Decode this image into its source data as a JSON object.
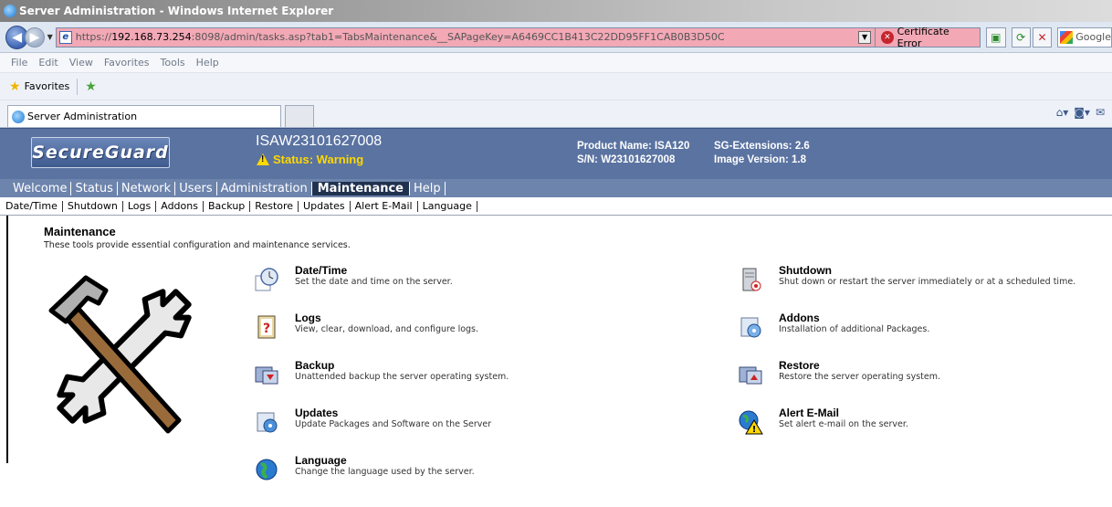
{
  "window": {
    "title": "Server Administration - Windows Internet Explorer"
  },
  "address": {
    "scheme": "https://",
    "host": "192.168.73.254",
    "rest": ":8098/admin/tasks.asp?tab1=TabsMaintenance&__SAPageKey=A6469CC1B413C22DD95FF1CAB0B3D50C",
    "cert_error": "Certificate Error",
    "search_placeholder": "Google"
  },
  "menu": [
    "File",
    "Edit",
    "View",
    "Favorites",
    "Tools",
    "Help"
  ],
  "favorites": {
    "label": "Favorites"
  },
  "browser_tab": {
    "label": "Server Administration"
  },
  "header": {
    "logo": "SecureGuard",
    "hostname": "ISAW23101627008",
    "status": "Status: Warning",
    "product_name": "Product Name: ISA120",
    "serial": "S/N: W23101627008",
    "sg_extensions": "SG-Extensions: 2.6",
    "image_version": "Image Version: 1.8"
  },
  "main_nav": [
    "Welcome",
    "Status",
    "Network",
    "Users",
    "Administration",
    "Maintenance",
    "Help"
  ],
  "sub_nav": [
    "Date/Time",
    "Shutdown",
    "Logs",
    "Addons",
    "Backup",
    "Restore",
    "Updates",
    "Alert E-Mail",
    "Language"
  ],
  "page": {
    "title": "Maintenance",
    "description": "These tools provide essential configuration and maintenance services."
  },
  "tasks": {
    "datetime": {
      "title": "Date/Time",
      "desc": "Set the date and time on the server."
    },
    "shutdown": {
      "title": "Shutdown",
      "desc": "Shut down or restart the server immediately or at a scheduled time."
    },
    "logs": {
      "title": "Logs",
      "desc": "View, clear, download, and configure logs."
    },
    "addons": {
      "title": "Addons",
      "desc": "Installation of additional Packages."
    },
    "backup": {
      "title": "Backup",
      "desc": "Unattended backup the server operating system."
    },
    "restore": {
      "title": "Restore",
      "desc": "Restore the server operating system."
    },
    "updates": {
      "title": "Updates",
      "desc": "Update Packages and Software on the Server"
    },
    "alertemail": {
      "title": "Alert E-Mail",
      "desc": "Set alert e-mail on the server."
    },
    "language": {
      "title": "Language",
      "desc": "Change the language used by the server."
    }
  },
  "colors": {
    "header_bg": "#5a73a1",
    "nav_bg": "#6d84ad",
    "nav_active": "#20324f",
    "status_warning": "#ffd800",
    "cert_error_bg": "#f2a8b5"
  }
}
